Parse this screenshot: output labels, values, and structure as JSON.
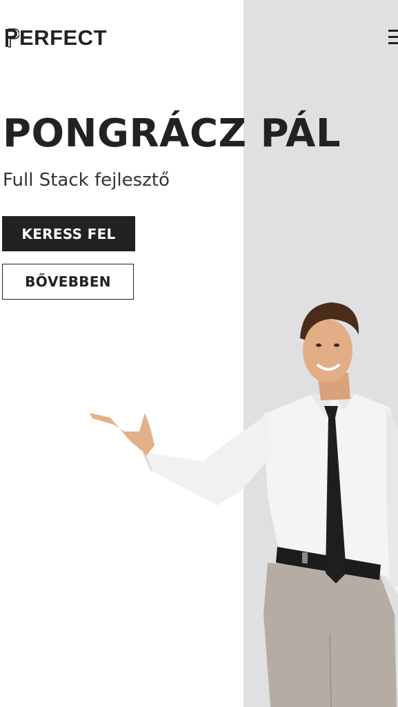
{
  "header": {
    "logo_text": "ERFECT",
    "logo_icon": "logo-p-mark",
    "menu_icon": "hamburger-menu-icon"
  },
  "hero": {
    "title": "PONGRÁCZ PÁL",
    "subtitle": "Full Stack fejlesztő",
    "primary_button_label": "KERESS FEL",
    "secondary_button_label": "BŐVEBBEN",
    "image": "man-in-white-shirt-and-tie-presenting"
  },
  "colors": {
    "text": "#222222",
    "panel_background": "#e0e0e2",
    "background": "#ffffff",
    "primary_button": "#222222"
  }
}
